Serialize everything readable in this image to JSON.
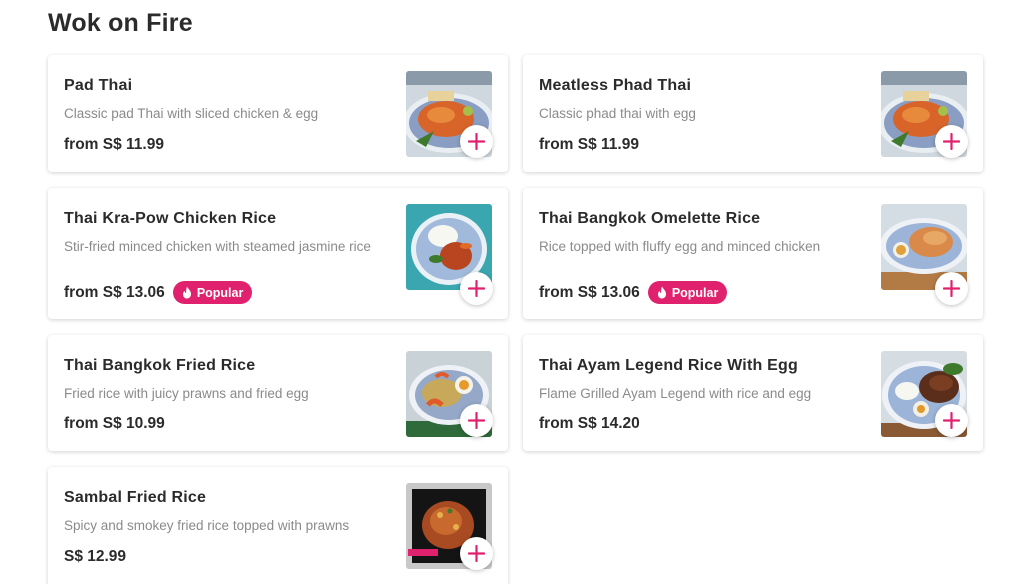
{
  "restaurant": {
    "title": "Wok on Fire"
  },
  "colors": {
    "accent": "#e0226e",
    "text": "#2b2b2b",
    "muted": "#8a8a8a"
  },
  "badge_label": "Popular",
  "items": [
    {
      "name": "Pad Thai",
      "description": "Classic pad Thai with sliced chicken & egg",
      "price": "from S$ 11.99",
      "popular": false,
      "image_icon": "pad-thai-photo"
    },
    {
      "name": "Meatless Phad Thai",
      "description": "Classic phad thai with egg",
      "price": "from S$ 11.99",
      "popular": false,
      "image_icon": "phad-thai-photo"
    },
    {
      "name": "Thai Kra-Pow Chicken Rice",
      "description": "Stir-fried minced chicken with steamed jasmine rice",
      "price": "from S$ 13.06",
      "popular": true,
      "image_icon": "kra-pow-rice-photo"
    },
    {
      "name": "Thai Bangkok Omelette Rice",
      "description": "Rice topped with fluffy egg and minced chicken",
      "price": "from S$ 13.06",
      "popular": true,
      "image_icon": "omelette-rice-photo"
    },
    {
      "name": "Thai Bangkok Fried Rice",
      "description": "Fried rice with juicy prawns and fried egg",
      "price": "from S$ 10.99",
      "popular": false,
      "image_icon": "fried-rice-photo"
    },
    {
      "name": "Thai Ayam Legend Rice With Egg",
      "description": "Flame Grilled Ayam Legend with rice and egg",
      "price": "from S$ 14.20",
      "popular": false,
      "image_icon": "ayam-rice-photo"
    },
    {
      "name": "Sambal Fried Rice",
      "description": "Spicy and smokey fried rice topped with prawns",
      "price": "S$ 12.99",
      "popular": false,
      "image_icon": "sambal-rice-photo"
    }
  ]
}
